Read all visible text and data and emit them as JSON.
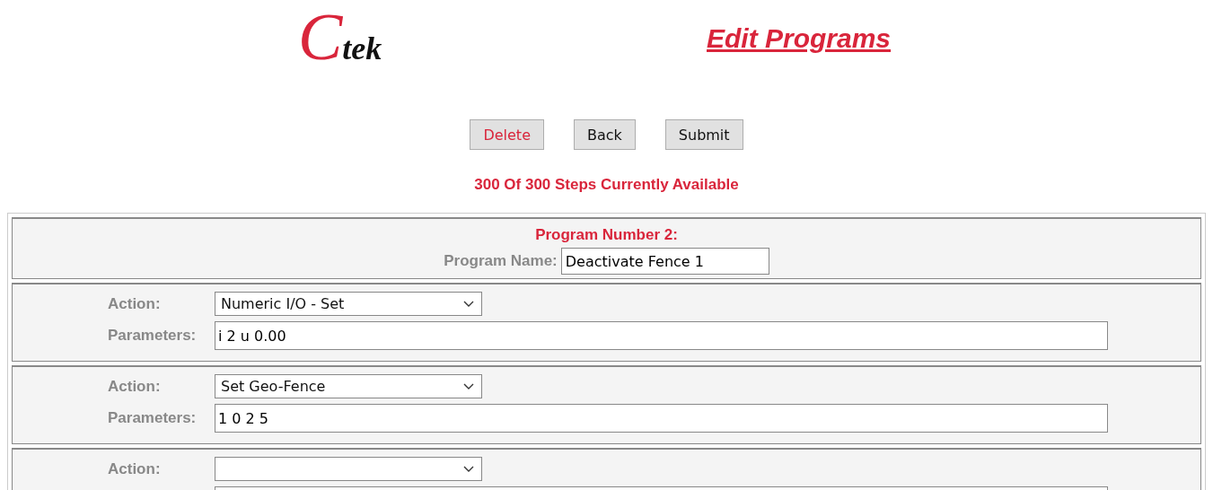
{
  "logo": {
    "initial": "C",
    "rest": "tek"
  },
  "title": "Edit Programs",
  "buttons": [
    {
      "label": "Delete",
      "kind": "danger"
    },
    {
      "label": "Back",
      "kind": "normal"
    },
    {
      "label": "Submit",
      "kind": "normal"
    }
  ],
  "status": "300 Of 300 Steps Currently Available",
  "program": {
    "number_label": "Program Number 2:",
    "name_label": "Program Name:",
    "name_value": "Deactivate Fence 1"
  },
  "steps": [
    {
      "action_label": "Action:",
      "action_value": "Numeric I/O - Set",
      "parameters_label": "Parameters:",
      "parameters_value": "i 2 u 0.00"
    },
    {
      "action_label": "Action:",
      "action_value": "Set Geo-Fence",
      "parameters_label": "Parameters:",
      "parameters_value": "1 0 2 5"
    },
    {
      "action_label": "Action:"
    }
  ]
}
